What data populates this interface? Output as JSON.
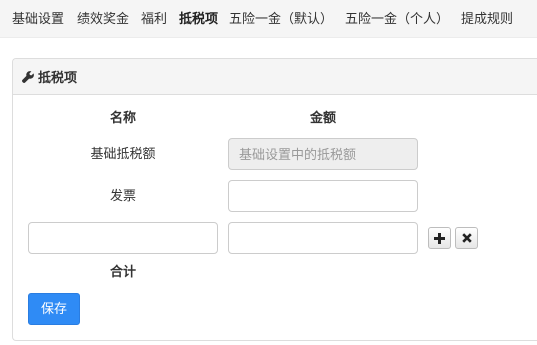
{
  "nav": {
    "tabs": [
      {
        "label": "基础设置",
        "active": false
      },
      {
        "label": "绩效奖金",
        "active": false
      },
      {
        "label": "福利",
        "active": false
      },
      {
        "label": "抵税项",
        "active": true
      },
      {
        "label": "五险一金（默认）",
        "active": false
      },
      {
        "label": "五险一金（个人）",
        "active": false
      },
      {
        "label": "提成规则",
        "active": false
      }
    ]
  },
  "panel": {
    "icon": "wrench-icon",
    "title": "抵税项"
  },
  "table": {
    "headers": {
      "name": "名称",
      "amount": "金额"
    },
    "rows": [
      {
        "name": "基础抵税额",
        "amount_placeholder": "基础设置中的抵税额",
        "amount_disabled": true
      },
      {
        "name": "发票",
        "amount_value": ""
      },
      {
        "name_value": "",
        "amount_value": "",
        "add_icon": "plus-icon",
        "remove_icon": "times-icon"
      }
    ],
    "total_label": "合计"
  },
  "actions": {
    "save_label": "保存"
  },
  "colors": {
    "accent": "#2f8bf5",
    "nav_bg": "#f5f5f5",
    "panel_header_bg": "#f5f5f5",
    "border": "#dddddd",
    "disabled_bg": "#eeeeee"
  }
}
